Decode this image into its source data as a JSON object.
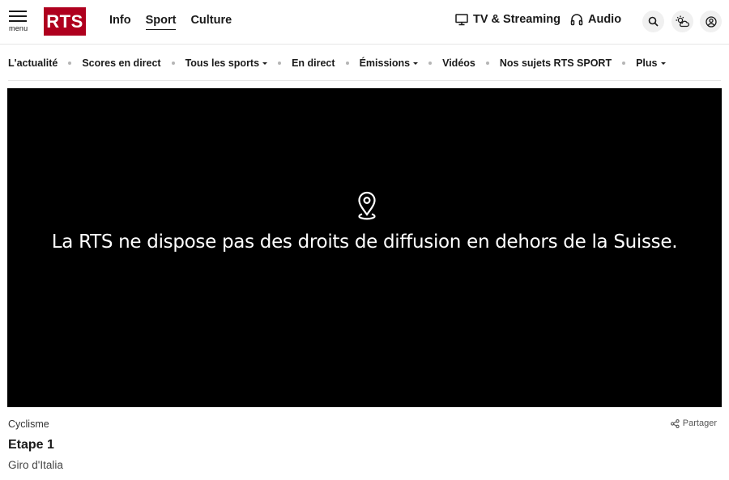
{
  "header": {
    "menu_label": "menu",
    "logo_text": "RTS",
    "brand_color": "#af001e",
    "nav": [
      {
        "label": "Info"
      },
      {
        "label": "Sport",
        "active": true
      },
      {
        "label": "Culture"
      }
    ],
    "tv_label": "TV & Streaming",
    "audio_label": "Audio",
    "icons": [
      "search-icon",
      "weather-icon",
      "account-icon"
    ]
  },
  "subnav": {
    "items": [
      {
        "label": "L'actualité",
        "dropdown": false
      },
      {
        "label": "Scores en direct",
        "dropdown": false
      },
      {
        "label": "Tous les sports",
        "dropdown": true
      },
      {
        "label": "En direct",
        "dropdown": false
      },
      {
        "label": "Émissions",
        "dropdown": true
      },
      {
        "label": "Vidéos",
        "dropdown": false
      },
      {
        "label": "Nos sujets RTS SPORT",
        "dropdown": false
      },
      {
        "label": "Plus",
        "dropdown": true
      }
    ]
  },
  "player": {
    "icon": "location-pin-icon",
    "message": "La RTS ne dispose pas des droits de diffusion en dehors de la Suisse."
  },
  "article": {
    "category": "Cyclisme",
    "share_label": "Partager",
    "title": "Etape 1",
    "subtitle": "Giro d'Italia"
  }
}
